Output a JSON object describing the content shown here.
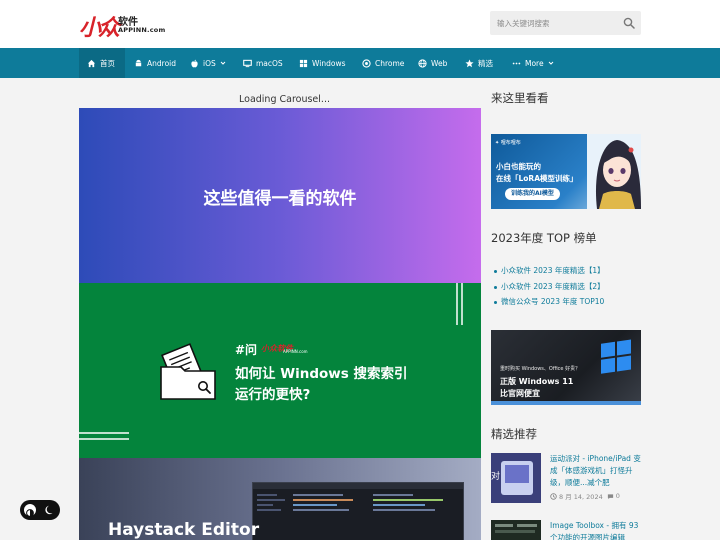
{
  "header": {
    "logo_mark": "小众",
    "logo_cn": "软件",
    "logo_en": "APPINN.com",
    "search_placeholder": "输入关键词搜索"
  },
  "nav": {
    "items": [
      {
        "label": "首页",
        "icon": "home-icon",
        "active": true
      },
      {
        "label": "Android",
        "icon": "android-icon"
      },
      {
        "label": "iOS",
        "icon": "apple-icon",
        "dropdown": true
      },
      {
        "label": "macOS",
        "icon": "monitor-icon"
      },
      {
        "label": "Windows",
        "icon": "windows-icon"
      },
      {
        "label": "Chrome",
        "icon": "chrome-icon"
      },
      {
        "label": "Web",
        "icon": "globe-icon"
      },
      {
        "label": "精选",
        "icon": "star-icon"
      },
      {
        "label": "More",
        "icon": "dots-icon",
        "dropdown": true
      }
    ],
    "accent": "#0e7b9a"
  },
  "carousel": {
    "loading_text": "Loading Carousel...",
    "slide1_title": "这些值得一看的软件",
    "slide2_tag": "#问",
    "slide2_brand": "小众软件",
    "slide2_brand_en": "APPINN.com",
    "slide2_line1": "如何让 Windows 搜索索引",
    "slide2_line2": "运行的更快?",
    "slide3_title": "Haystack Editor"
  },
  "sidebar": {
    "section1_title": "来这里看看",
    "banner1": {
      "brand": "✦ 哩布哩布",
      "line1": "小白也能玩的",
      "line2": "在线「LoRA模型训练」",
      "pill": "训练我的AI模型"
    },
    "section2_title": "2023年度 TOP 榜单",
    "top_list": [
      "小众软件 2023 年度精选【1】",
      "小众软件 2023 年度精选【2】",
      "微信公众号 2023 年度 TOP10"
    ],
    "banner2": {
      "small": "重时购买 Windows、Office 好贵？",
      "line1": "正版 Windows 11",
      "line2": "比官网便宜"
    },
    "section3_title": "精选推荐",
    "recommended": [
      {
        "title": "运动派对 - iPhone/iPad 变成「体感游戏机」打怪升级，顺便...减个肥",
        "date": "8 月 14, 2024",
        "comments": "0"
      },
      {
        "title": "Image Toolbox - 拥有 93 个功能的开源图片编辑",
        "date": "",
        "comments": ""
      }
    ]
  }
}
